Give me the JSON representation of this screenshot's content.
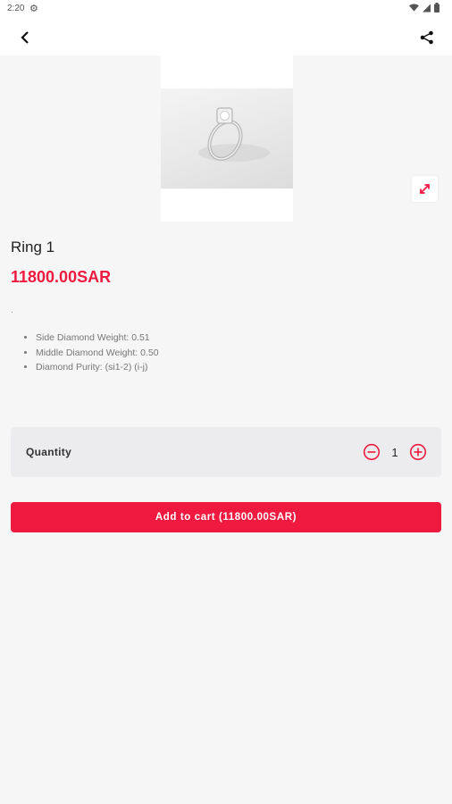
{
  "status_bar": {
    "time": "2:20",
    "gear_icon": "gear-icon",
    "wifi_icon": "wifi-icon",
    "signal_icon": "signal-icon",
    "battery_icon": "battery-icon"
  },
  "appbar": {
    "back_icon": "back-arrow-icon",
    "share_icon": "share-icon"
  },
  "product": {
    "image": "ring-photo",
    "expand_icon": "expand-icon",
    "name": "Ring 1",
    "price": "11800.00SAR",
    "description_dot": ".",
    "features": [
      "Side Diamond Weight: 0.51",
      "Middle Diamond Weight: 0.50",
      "Diamond Purity: (si1-2) (i-j)"
    ]
  },
  "quantity": {
    "label": "Quantity",
    "value": "1",
    "minus_icon": "minus-circle-icon",
    "plus_icon": "plus-circle-icon"
  },
  "cart": {
    "button_label": "Add to cart (11800.00SAR)"
  },
  "colors": {
    "accent": "#f0193f",
    "background": "#f6f6f6",
    "quantity_bg": "#ececee"
  }
}
